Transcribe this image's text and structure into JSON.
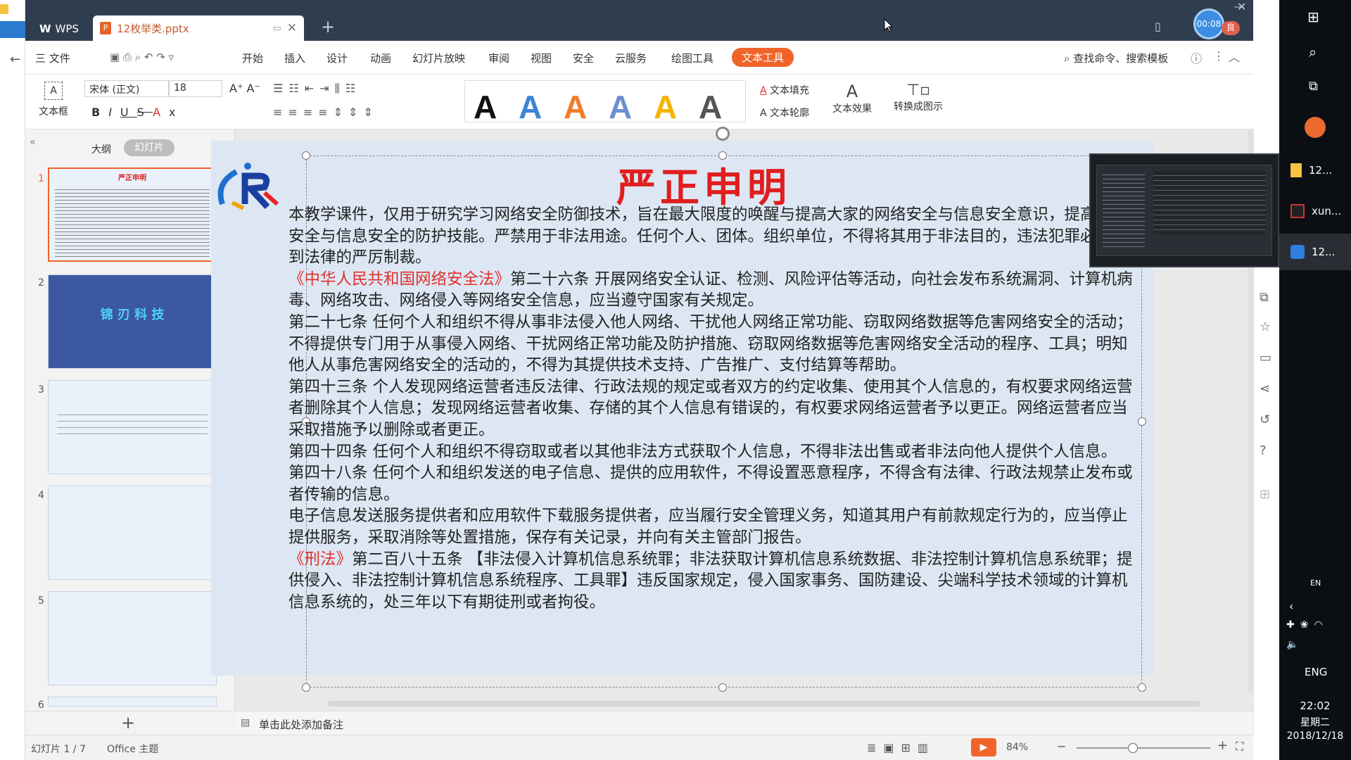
{
  "tabs": {
    "wps_label": "WPS",
    "doc_label": "12枚举类.pptx"
  },
  "menu": {
    "items": [
      "三 文件",
      "开始",
      "插入",
      "设计",
      "动画",
      "幻灯片放映",
      "审阅",
      "视图",
      "安全",
      "云服务",
      "绘图工具"
    ],
    "active": "文本工具",
    "search": "查找命令、搜索模板"
  },
  "timer": "00:08",
  "toolbar": {
    "textbox_label": "文本框",
    "font_name": "宋体 (正文)",
    "font_size": "18",
    "fill_label": "文本填充",
    "outline_label": "文本轮廓",
    "effect_label": "文本效果",
    "convert_label": "转换成图示",
    "art_letter": "A",
    "art_colors": [
      "#111111",
      "#3a86d4",
      "#f07d2a",
      "#6c8fd0",
      "#f5b400",
      "#555555"
    ]
  },
  "panel": {
    "outline_tab": "大纲",
    "slides_tab": "幻灯片",
    "numbers": [
      "1",
      "2",
      "3",
      "4",
      "5",
      "6"
    ],
    "thumb1_title": "严正申明",
    "thumb2_title": "锦 刃 科 技"
  },
  "slide": {
    "title": "严正申明",
    "p1": "本教学课件，仅用于研究学习网络安全防御技术，旨在最大限度的唤醒与提高大家的网络安全与信息安全意识，提高网络安全与信息安全的防护技能。严禁用于非法用途。任何个人、团体。组织单位，不得将其用于非法目的，违法犯罪必将受到法律的严厉制裁。",
    "law1": "《中华人民共和国网络安全法》",
    "p2": "第二十六条 开展网络安全认证、检测、风险评估等活动，向社会发布系统漏洞、计算机病毒、网络攻击、网络侵入等网络安全信息，应当遵守国家有关规定。",
    "p3": "第二十七条 任何个人和组织不得从事非法侵入他人网络、干扰他人网络正常功能、窃取网络数据等危害网络安全的活动；不得提供专门用于从事侵入网络、干扰网络正常功能及防护措施、窃取网络数据等危害网络安全活动的程序、工具；明知他人从事危害网络安全的活动的，不得为其提供技术支持、广告推广、支付结算等帮助。",
    "p4": "第四十三条 个人发现网络运营者违反法律、行政法规的规定或者双方的约定收集、使用其个人信息的，有权要求网络运营者删除其个人信息；发现网络运营者收集、存储的其个人信息有错误的，有权要求网络运营者予以更正。网络运营者应当采取措施予以删除或者更正。",
    "p5": "第四十四条 任何个人和组织不得窃取或者以其他非法方式获取个人信息，不得非法出售或者非法向他人提供个人信息。",
    "p6": "第四十八条 任何个人和组织发送的电子信息、提供的应用软件，不得设置恶意程序，不得含有法律、行政法规禁止发布或者传输的信息。",
    "p7": "电子信息发送服务提供者和应用软件下载服务提供者，应当履行安全管理义务，知道其用户有前款规定行为的，应当停止提供服务，采取消除等处置措施，保存有关记录，并向有关主管部门报告。",
    "law2": "《刑法》",
    "p8": "第二百八十五条  【非法侵入计算机信息系统罪；非法获取计算机信息系统数据、非法控制计算机信息系统罪；提供侵入、非法控制计算机信息系统程序、工具罪】违反国家规定，侵入国家事务、国防建设、尖端科学技术领域的计算机信息系统的，处三年以下有期徒刑或者拘役。"
  },
  "notes": "单击此处添加备注",
  "status": {
    "slide_info": "幻灯片 1 / 7",
    "theme": "Office 主题",
    "zoom": "84%",
    "zoom_level": 0.42
  },
  "taskbar": {
    "items": [
      "12...",
      "xun...",
      "12..."
    ],
    "lang": "ENG",
    "lang_small": "EN",
    "time": "22:02",
    "weekday": "星期二",
    "date": "2018/12/18"
  },
  "colors": {
    "accent": "#f0642a",
    "title_red": "#e11d1d",
    "titlebar": "#2f3e4e"
  }
}
